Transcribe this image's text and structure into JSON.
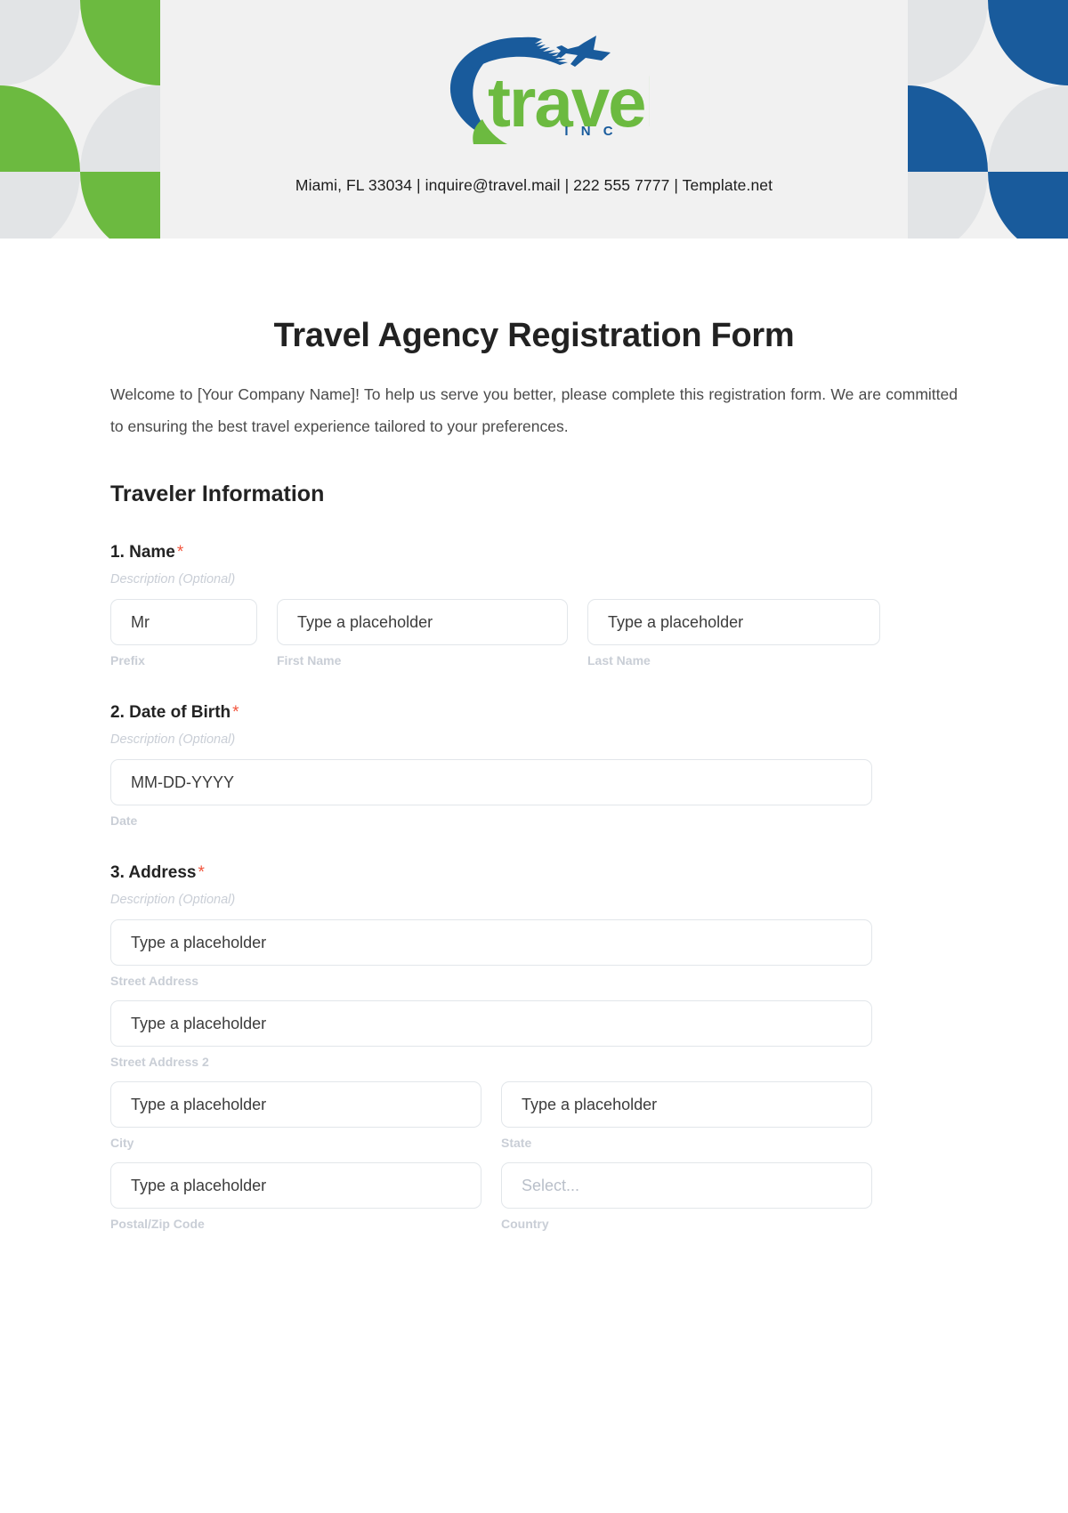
{
  "header": {
    "logo": {
      "brand_name": "travel",
      "brand_suffix": "I N C",
      "icon_name": "airplane-swoosh-logo",
      "green": "#6cba40",
      "blue": "#195b9c"
    },
    "contact_line": "Miami, FL 33034 | inquire@travel.mail | 222 555 7777 | Template.net",
    "decor": {
      "green": "#6cba40",
      "blue": "#195b9c",
      "grey": "#e2e4e6",
      "background": "#f1f1f1"
    }
  },
  "form": {
    "title": "Travel Agency Registration Form",
    "intro": "Welcome to [Your Company Name]! To help us serve you better, please complete this registration form. We are committed to ensuring the best travel experience tailored to your preferences.",
    "section_title": "Traveler Information",
    "required_marker": "*",
    "description_placeholder": "Description (Optional)",
    "questions": [
      {
        "label": "1. Name",
        "description": "Description (Optional)",
        "fields": [
          {
            "value": "Mr",
            "sub_label": "Prefix"
          },
          {
            "value": "Type a placeholder",
            "sub_label": "First Name"
          },
          {
            "value": "Type a placeholder",
            "sub_label": "Last Name"
          }
        ]
      },
      {
        "label": "2. Date of Birth",
        "description": "Description (Optional)",
        "fields": [
          {
            "value": "MM-DD-YYYY",
            "sub_label": "Date"
          }
        ]
      },
      {
        "label": "3. Address",
        "description": "Description (Optional)",
        "fields": [
          {
            "value": "Type a placeholder",
            "sub_label": "Street Address"
          },
          {
            "value": "Type a placeholder",
            "sub_label": "Street Address 2"
          },
          {
            "value": "Type a placeholder",
            "sub_label": "City"
          },
          {
            "value": "Type a placeholder",
            "sub_label": "State"
          },
          {
            "value": "Type a placeholder",
            "sub_label": "Postal/Zip Code"
          },
          {
            "value": "Select...",
            "sub_label": "Country"
          }
        ]
      }
    ]
  }
}
